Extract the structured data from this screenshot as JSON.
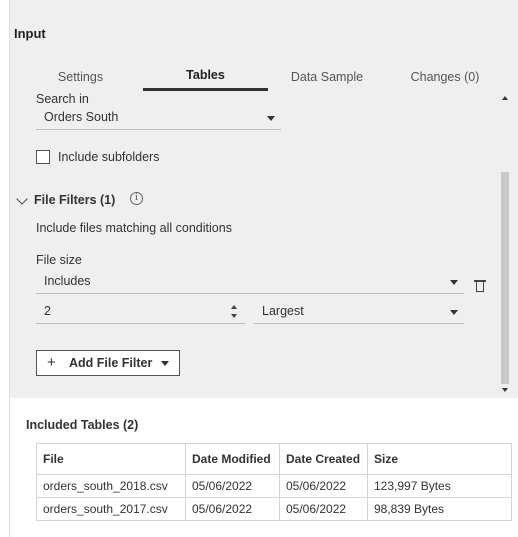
{
  "panel": {
    "title": "Input"
  },
  "tabs": [
    {
      "label": "Settings",
      "active": false
    },
    {
      "label": "Tables",
      "active": true
    },
    {
      "label": "Data Sample",
      "active": false
    },
    {
      "label": "Changes (0)",
      "active": false
    }
  ],
  "search": {
    "label": "Search in",
    "value": "Orders South"
  },
  "subfolders": {
    "label": "Include subfolders",
    "checked": false
  },
  "file_filters": {
    "heading": "File Filters (1)",
    "description": "Include files matching all conditions",
    "filter": {
      "field_label": "File size",
      "operator": "Includes",
      "count": "2",
      "mode": "Largest"
    },
    "add_button": "Add File Filter"
  },
  "included_tables": {
    "title": "Included Tables (2)",
    "columns": [
      "File",
      "Date Modified",
      "Date Created",
      "Size"
    ],
    "rows": [
      [
        "orders_south_2018.csv",
        "05/06/2022",
        "05/06/2022",
        "123,997 Bytes"
      ],
      [
        "orders_south_2017.csv",
        "05/06/2022",
        "05/06/2022",
        "98,839 Bytes"
      ]
    ]
  },
  "icons": {
    "info": "info-circle-icon",
    "delete": "trash-icon",
    "expand": "chevron-down-icon",
    "add": "plus-icon"
  },
  "colors": {
    "panel_bg": "#efefef",
    "tab_active": "#333333"
  }
}
